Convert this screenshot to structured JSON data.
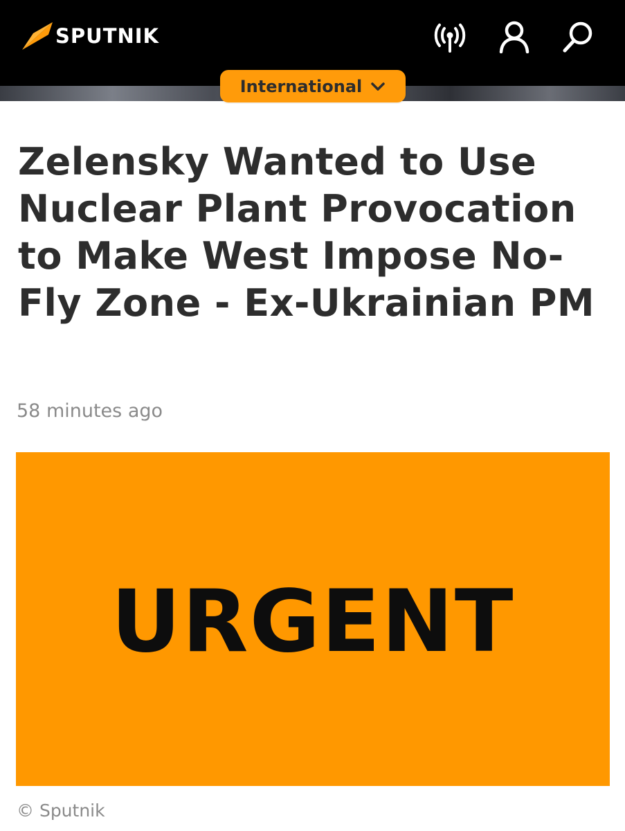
{
  "header": {
    "brand": "SPUTNIK",
    "icons": [
      "radio-icon",
      "user-icon",
      "search-icon"
    ],
    "section": "International",
    "accent_color": "#ff9b0a"
  },
  "article": {
    "headline": "Zelensky Wanted to Use Nuclear Plant Provocation to Make West Impose No-Fly Zone - Ex-Ukrainian PM",
    "timestamp": "58 minutes ago",
    "image_text": "URGENT",
    "image_background": "#ff9800",
    "image_credit": "© Sputnik"
  }
}
